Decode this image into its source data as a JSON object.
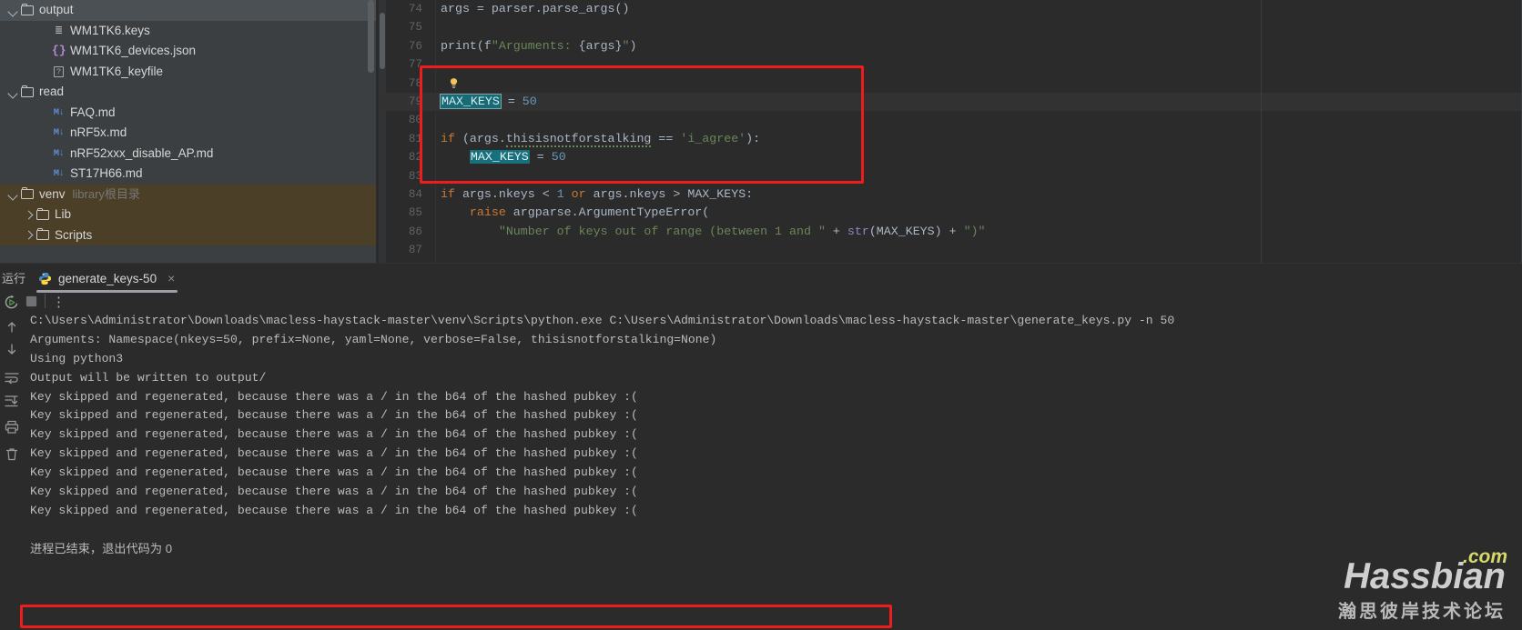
{
  "project_tree": {
    "rows": [
      {
        "indent": 1,
        "arrow": "down",
        "kind": "folder",
        "label": "output",
        "state": "selected",
        "note": ""
      },
      {
        "indent": 3,
        "arrow": "none",
        "kind": "keys",
        "label": "WM1TK6.keys",
        "state": "",
        "note": ""
      },
      {
        "indent": 3,
        "arrow": "none",
        "kind": "json",
        "label": "WM1TK6_devices.json",
        "state": "",
        "note": ""
      },
      {
        "indent": 3,
        "arrow": "none",
        "kind": "unknown",
        "label": "WM1TK6_keyfile",
        "state": "",
        "note": ""
      },
      {
        "indent": 1,
        "arrow": "down",
        "kind": "folder",
        "label": "read",
        "state": "",
        "note": ""
      },
      {
        "indent": 3,
        "arrow": "none",
        "kind": "md",
        "label": "FAQ.md",
        "state": "",
        "note": ""
      },
      {
        "indent": 3,
        "arrow": "none",
        "kind": "md",
        "label": "nRF5x.md",
        "state": "",
        "note": ""
      },
      {
        "indent": 3,
        "arrow": "none",
        "kind": "md",
        "label": "nRF52xxx_disable_AP.md",
        "state": "",
        "note": ""
      },
      {
        "indent": 3,
        "arrow": "none",
        "kind": "md",
        "label": "ST17H66.md",
        "state": "",
        "note": ""
      },
      {
        "indent": 1,
        "arrow": "down",
        "kind": "folder",
        "label": "venv",
        "state": "excluded",
        "note": "library根目录"
      },
      {
        "indent": 2,
        "arrow": "right",
        "kind": "folder",
        "label": "Lib",
        "state": "excluded",
        "note": ""
      },
      {
        "indent": 2,
        "arrow": "right",
        "kind": "folder",
        "label": "Scripts",
        "state": "excluded",
        "note": ""
      }
    ]
  },
  "editor": {
    "lines": [
      {
        "num": "74",
        "code": "args = parser.parse_args()"
      },
      {
        "num": "75",
        "code": ""
      },
      {
        "num": "76",
        "code": "print(f\"Arguments: {args}\")"
      },
      {
        "num": "77",
        "code": ""
      },
      {
        "num": "78",
        "code": ""
      },
      {
        "num": "79",
        "code": "MAX_KEYS = 50"
      },
      {
        "num": "80",
        "code": ""
      },
      {
        "num": "81",
        "code": "if (args.thisisnotforstalking == 'i_agree'):"
      },
      {
        "num": "82",
        "code": "    MAX_KEYS = 50"
      },
      {
        "num": "83",
        "code": ""
      },
      {
        "num": "84",
        "code": "if args.nkeys < 1 or args.nkeys > MAX_KEYS:"
      },
      {
        "num": "85",
        "code": "    raise argparse.ArgumentTypeError("
      },
      {
        "num": "86",
        "code": "        \"Number of keys out of range (between 1 and \" + str(MAX_KEYS) + \")\""
      },
      {
        "num": "87",
        "code": ""
      }
    ],
    "highlighted_identifier": "MAX_KEYS",
    "annotation_color": "#ee1c1c"
  },
  "run_window": {
    "side_label": "运行",
    "tab": {
      "label": "generate_keys-50",
      "icon": "python-icon",
      "close": "×"
    },
    "toolbar": {
      "rerun": "rerun-icon",
      "stop": "stop-icon",
      "more": "⋮"
    },
    "rail_icons": [
      "up-arrow-icon",
      "down-arrow-icon",
      "soft-wrap-icon",
      "scroll-to-end-icon",
      "print-icon",
      "trash-icon"
    ],
    "console": {
      "lines": [
        "C:\\Users\\Administrator\\Downloads\\macless-haystack-master\\venv\\Scripts\\python.exe C:\\Users\\Administrator\\Downloads\\macless-haystack-master\\generate_keys.py -n 50",
        "Arguments: Namespace(nkeys=50, prefix=None, yaml=None, verbose=False, thisisnotforstalking=None)",
        "Using python3",
        "Output will be written to output/",
        "Key skipped and regenerated, because there was a / in the b64 of the hashed pubkey :(",
        "Key skipped and regenerated, because there was a / in the b64 of the hashed pubkey :(",
        "Key skipped and regenerated, because there was a / in the b64 of the hashed pubkey :(",
        "Key skipped and regenerated, because there was a / in the b64 of the hashed pubkey :(",
        "Key skipped and regenerated, because there was a / in the b64 of the hashed pubkey :(",
        "Key skipped and regenerated, because there was a / in the b64 of the hashed pubkey :(",
        "Key skipped and regenerated, because there was a / in the b64 of the hashed pubkey :(",
        "",
        "进程已结束，退出代码为 0"
      ]
    }
  },
  "watermark": {
    "main": "Hassbian",
    "tld": ".com",
    "sub": "瀚思彼岸技术论坛"
  }
}
